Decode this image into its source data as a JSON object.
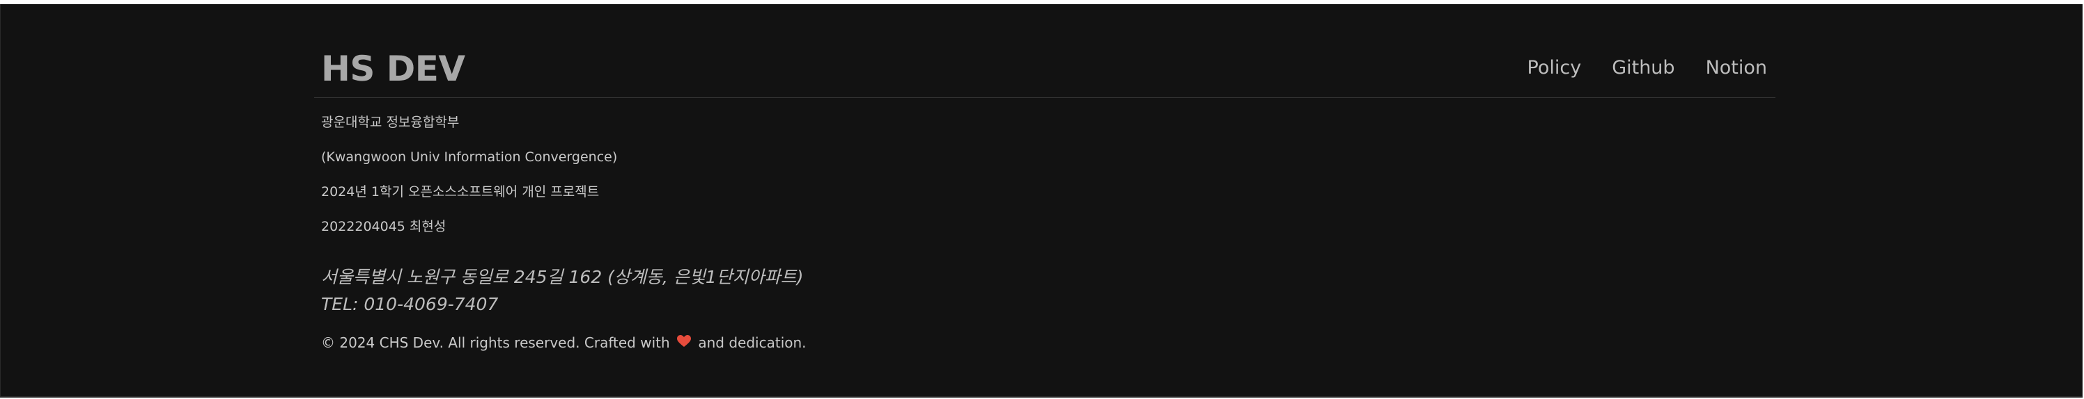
{
  "footer": {
    "brand": "HS DEV",
    "nav": [
      {
        "label": "Policy"
      },
      {
        "label": "Github"
      },
      {
        "label": "Notion"
      }
    ],
    "info_lines": [
      "광운대학교 정보융합학부",
      "(Kwangwoon Univ Information Convergence)",
      "2024년 1학기 오픈소스소프트웨어 개인 프로젝트",
      "2022204045 최현성"
    ],
    "address": "서울특별시 노원구 동일로 245길 162 (상계동, 은빛1단지아파트)",
    "tel": "TEL: 010-4069-7407",
    "copyright_prefix": "© 2024 CHS Dev. All rights reserved. Crafted with",
    "copyright_suffix": "and dedication.",
    "heart_icon": "heart-icon",
    "colors": {
      "background": "#121212",
      "brand": "#a8a8a8",
      "nav": "#bdbdbd",
      "text": "#c9c9c9",
      "heart": "#e74c3c"
    }
  }
}
